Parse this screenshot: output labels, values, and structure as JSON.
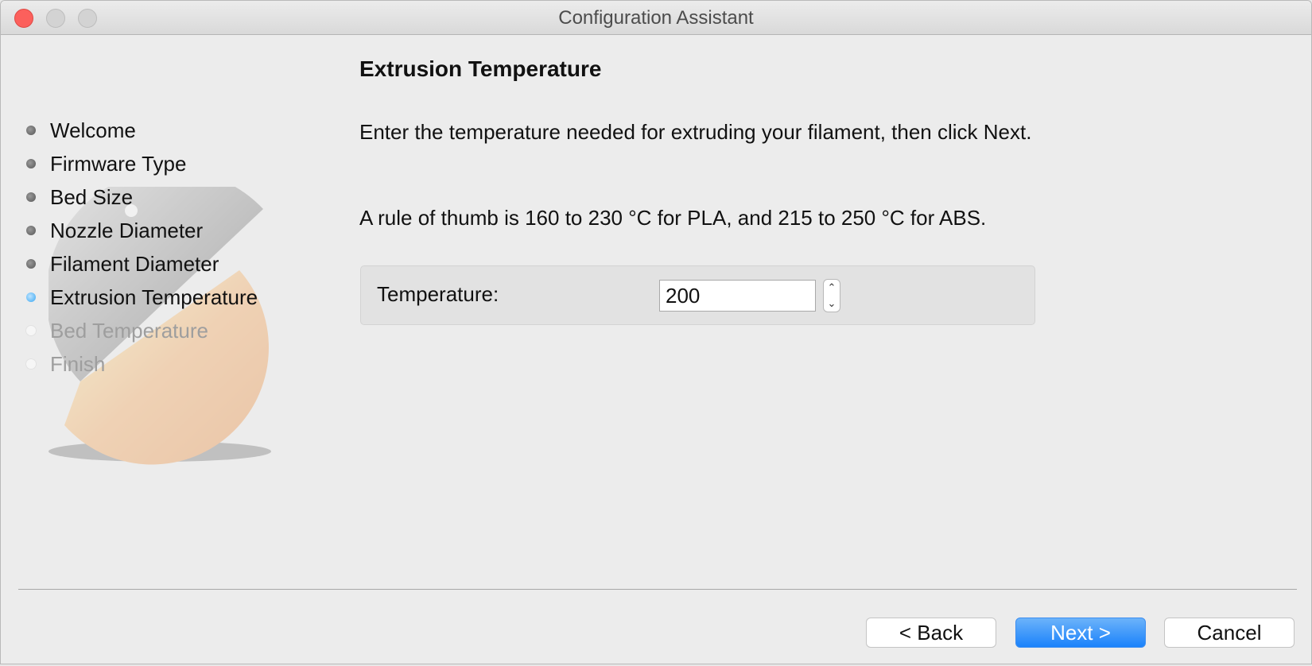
{
  "window": {
    "title": "Configuration Assistant"
  },
  "steps": [
    {
      "label": "Welcome",
      "state": "done"
    },
    {
      "label": "Firmware Type",
      "state": "done"
    },
    {
      "label": "Bed Size",
      "state": "done"
    },
    {
      "label": "Nozzle Diameter",
      "state": "done"
    },
    {
      "label": "Filament Diameter",
      "state": "done"
    },
    {
      "label": "Extrusion Temperature",
      "state": "active"
    },
    {
      "label": "Bed Temperature",
      "state": "pending"
    },
    {
      "label": "Finish",
      "state": "pending"
    }
  ],
  "page": {
    "heading": "Extrusion Temperature",
    "instruction": "Enter the temperature needed for extruding your filament, then click Next.",
    "hint": "A rule of thumb is 160 to 230 °C for PLA, and 215 to 250 °C for ABS.",
    "temperature_label": "Temperature:",
    "temperature_value": "200"
  },
  "buttons": {
    "back": "< Back",
    "next": "Next >",
    "cancel": "Cancel"
  },
  "colors": {
    "close_button": "#fc605c",
    "active_step_dot": "#38a7f2",
    "primary_button": "#1a82fb"
  },
  "icons": {
    "close": "close-icon",
    "minimize": "minimize-icon",
    "zoom": "zoom-icon",
    "stepper_up": "chevron-up-icon",
    "stepper_down": "chevron-down-icon",
    "logo": "slic3r-logo"
  }
}
